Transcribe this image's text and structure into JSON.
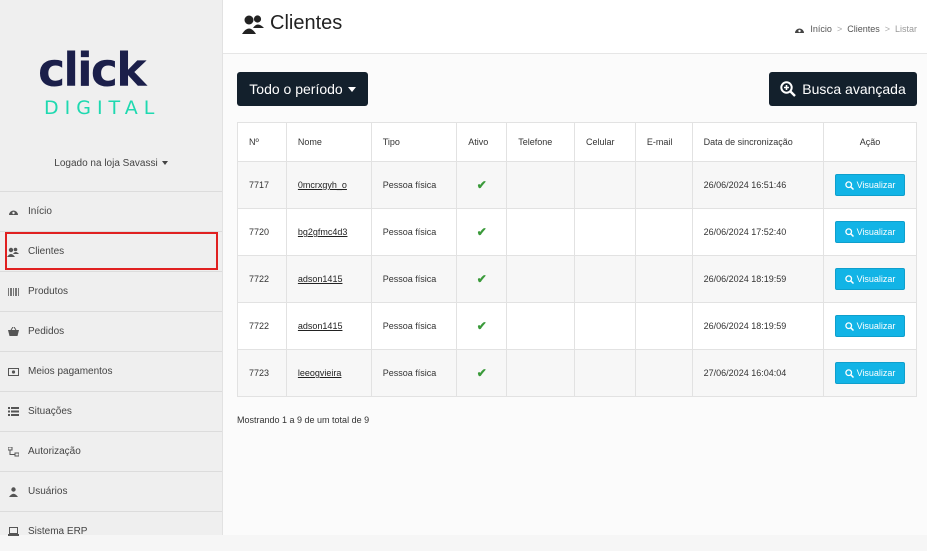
{
  "brand": {
    "name_main": "click",
    "name_sub": "DIGITAL",
    "color_dark": "#1b1f4a",
    "color_accent": "#1ed9b0"
  },
  "sidebar": {
    "store_label": "Logado na loja Savassi",
    "items": [
      {
        "label": "Início",
        "icon": "dashboard-icon"
      },
      {
        "label": "Clientes",
        "icon": "users-icon"
      },
      {
        "label": "Produtos",
        "icon": "barcode-icon"
      },
      {
        "label": "Pedidos",
        "icon": "basket-icon"
      },
      {
        "label": "Meios pagamentos",
        "icon": "money-icon"
      },
      {
        "label": "Situações",
        "icon": "list-icon"
      },
      {
        "label": "Autorização",
        "icon": "sitemap-icon"
      },
      {
        "label": "Usuários",
        "icon": "user-icon"
      },
      {
        "label": "Sistema ERP",
        "icon": "laptop-icon"
      }
    ]
  },
  "header": {
    "title": "Clientes",
    "breadcrumb": {
      "home": "Início",
      "section": "Clientes",
      "current": "Listar"
    }
  },
  "toolbar": {
    "period_label": "Todo o período",
    "search_label": "Busca avançada"
  },
  "table": {
    "columns": [
      "Nº",
      "Nome",
      "Tipo",
      "Ativo",
      "Telefone",
      "Celular",
      "E-mail",
      "Data de sincronização",
      "Ação"
    ],
    "action_label": "Visualizar",
    "rows": [
      {
        "id": "7717",
        "name": "0mcrxgyh_o",
        "type": "Pessoa física",
        "active": "✔",
        "phone": "",
        "mobile": "",
        "email": "",
        "sync": "26/06/2024 16:51:46"
      },
      {
        "id": "7720",
        "name": "bg2gfmc4d3",
        "type": "Pessoa física",
        "active": "✔",
        "phone": "",
        "mobile": "",
        "email": "",
        "sync": "26/06/2024 17:52:40"
      },
      {
        "id": "7722",
        "name": "adson1415",
        "type": "Pessoa física",
        "active": "✔",
        "phone": "",
        "mobile": "",
        "email": "",
        "sync": "26/06/2024 18:19:59"
      },
      {
        "id": "7722",
        "name": "adson1415",
        "type": "Pessoa física",
        "active": "✔",
        "phone": "",
        "mobile": "",
        "email": "",
        "sync": "26/06/2024 18:19:59"
      },
      {
        "id": "7723",
        "name": "leeogvieira",
        "type": "Pessoa física",
        "active": "✔",
        "phone": "",
        "mobile": "",
        "email": "",
        "sync": "27/06/2024 16:04:04"
      }
    ]
  },
  "footer": {
    "summary": "Mostrando 1 a 9 de um total de 9"
  }
}
